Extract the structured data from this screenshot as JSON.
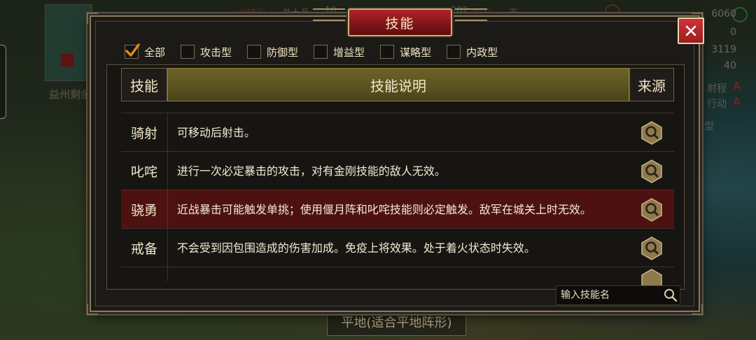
{
  "background": {
    "minimap_label": "益州剩余",
    "top_texts": [
      "刘璋军",
      "总士兵",
      "10",
      "202",
      "据军",
      "无"
    ],
    "stats": [
      "6060",
      "0",
      "3119",
      "40"
    ],
    "side_labels": [
      {
        "label": "射程",
        "grade": "A"
      },
      {
        "label": "行动",
        "grade": "A"
      }
    ],
    "side_type": "型",
    "terrain": "平地(适合平地阵形)"
  },
  "dialog": {
    "title": "技能",
    "filters": [
      {
        "label": "全部",
        "checked": true
      },
      {
        "label": "攻击型",
        "checked": false
      },
      {
        "label": "防御型",
        "checked": false
      },
      {
        "label": "增益型",
        "checked": false
      },
      {
        "label": "谋略型",
        "checked": false
      },
      {
        "label": "内政型",
        "checked": false
      }
    ],
    "headers": {
      "skill": "技能",
      "description": "技能说明",
      "source": "来源"
    },
    "rows": [
      {
        "name": "骑射",
        "desc": "可移动后射击。",
        "selected": false
      },
      {
        "name": "叱咤",
        "desc": "进行一次必定暴击的攻击，对有金刚技能的敌人无效。",
        "selected": false
      },
      {
        "name": "骁勇",
        "desc": "近战暴击可能触发单挑；使用偃月阵和叱咤技能则必定触发。敌军在城关上时无效。",
        "selected": true
      },
      {
        "name": "戒备",
        "desc": "不会受到因包围造成的伤害加成。免疫上将效果。处于着火状态时失效。",
        "selected": false
      }
    ],
    "search": {
      "placeholder": "输入技能名"
    }
  },
  "colors": {
    "title_red": "#a31d22",
    "selected_row": "#4d1111",
    "header_gold": "#5a5121",
    "check_orange": "#e58a1f"
  }
}
